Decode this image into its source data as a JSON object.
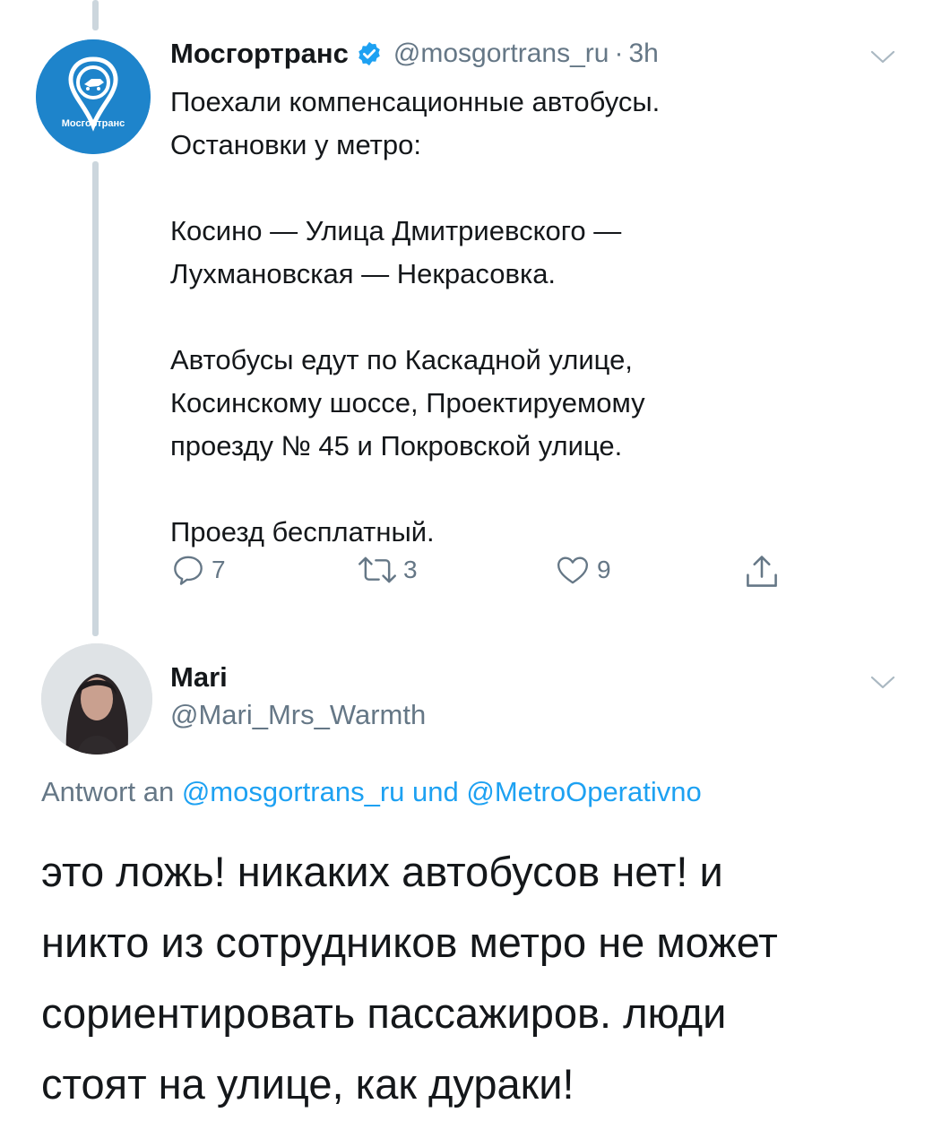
{
  "tweet": {
    "author_name": "Мосгортранс",
    "handle": "@mosgortrans_ru",
    "separator": "·",
    "time": "3h",
    "avatar_label": "Мосгортранс",
    "text": "Поехали компенсационные автобусы.\nОстановки у метро:\n\nКосино — Улица Дмитриевского —\nЛухмановская — Некрасовка.\n\nАвтобусы едут по Каскадной улице,\nКосинскому шоссе, Проектируемому\nпроезду № 45 и Покровской улице.\n\nПроезд бесплатный.",
    "replies": "7",
    "retweets": "3",
    "likes": "9"
  },
  "reply": {
    "author_name": "Mari",
    "handle": "@Mari_Mrs_Warmth",
    "reply_prefix": "Antwort an",
    "mention_1": "@mosgortrans_ru",
    "conjunction": "und",
    "mention_2": "@MetroOperativno",
    "text": "это ложь! никаких автобусов нет! и\nникто из сотрудников метро не может\nсориентировать пассажиров. люди\nстоят на улице, как дураки!"
  },
  "icons": {
    "verified": "verified-badge-icon",
    "chevron": "chevron-down-icon",
    "reply": "reply-icon",
    "retweet": "retweet-icon",
    "like": "heart-icon",
    "share": "share-icon"
  },
  "colors": {
    "brand_blue": "#1da1f2",
    "mosgortrans_blue": "#1e84cb",
    "secondary_text": "#657786",
    "thread_line": "#ccd6dd"
  }
}
